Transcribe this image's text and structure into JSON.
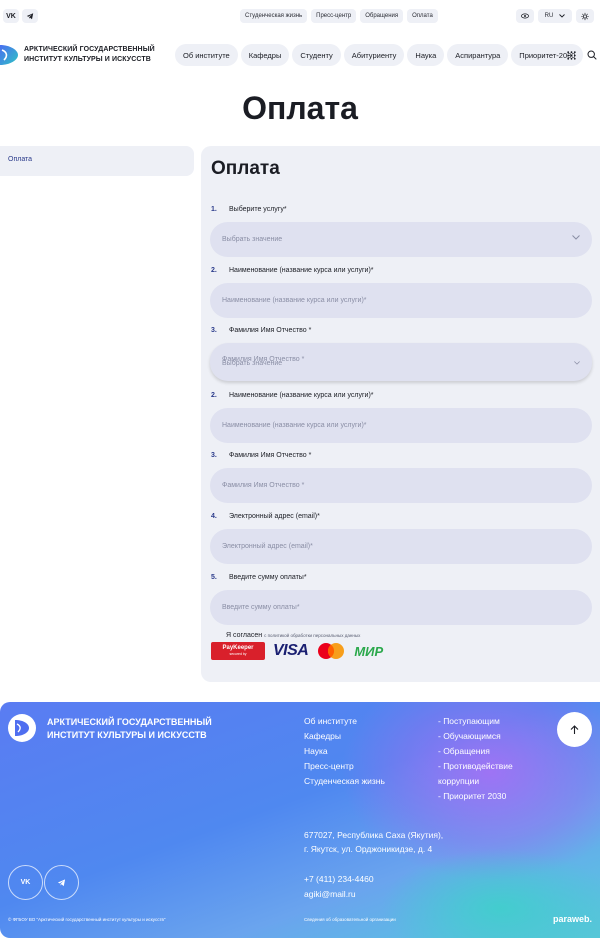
{
  "topbar": {
    "vk_label": "VK",
    "telegram_icon": "telegram-icon",
    "links": [
      "Студенческая жизнь",
      "Пресс-центр",
      "Обращения",
      "Оплата"
    ],
    "lang": "RU"
  },
  "header": {
    "logo_line1": "АРКТИЧЕСКИЙ ГОСУДАРСТВЕННЫЙ",
    "logo_line2": "ИНСТИТУТ КУЛЬТУРЫ И ИСКУССТВ",
    "nav": [
      "Об институте",
      "Кафедры",
      "Студенту",
      "Абитуриенту",
      "Наука",
      "Аспирантура",
      "Приоритет-2030"
    ]
  },
  "page": {
    "title": "Оплата"
  },
  "sidebar": {
    "items": [
      {
        "label": "Оплата"
      }
    ]
  },
  "form": {
    "title": "Оплата",
    "questions": [
      {
        "num": "1.",
        "label": "Выберите услугу*",
        "placeholder": "Выбрать значение",
        "type": "select"
      },
      {
        "num": "2.",
        "label": "Наименование (название курса или услуги)*",
        "placeholder": "Наименование (название курса или услуги)*",
        "type": "text"
      },
      {
        "num": "3.",
        "label": "Фамилия Имя Отчество *",
        "placeholder": "Фамилия Имя Отчество *",
        "overlap": "Выбрать значение",
        "type": "select"
      },
      {
        "num": "2.",
        "label": "Наименование (название курса или услуги)*",
        "placeholder": "Наименование (название курса или услуги)*",
        "type": "text"
      },
      {
        "num": "3.",
        "label": "Фамилия Имя Отчество *",
        "placeholder": "Фамилия Имя Отчество *",
        "type": "text"
      },
      {
        "num": "4.",
        "label": "Электронный адрес (email)*",
        "placeholder": "Электронный адрес (email)*",
        "type": "text"
      },
      {
        "num": "5.",
        "label": "Введите сумму оплаты*",
        "placeholder": "Введите сумму оплаты*",
        "type": "text"
      }
    ],
    "agree_text": "Я согласен",
    "agree_small": "с политикой обработки персональных данных",
    "paykeeper": "PayKeeper",
    "paykeeper_sub": "secured by",
    "visa": "VISA",
    "mastercard": "mastercard",
    "mir": "МИР"
  },
  "footer": {
    "brand_line1": "АРКТИЧЕСКИЙ ГОСУДАРСТВЕННЫЙ",
    "brand_line2": "ИНСТИТУТ КУЛЬТУРЫ И ИСКУССТВ",
    "col1": [
      "Об институте",
      "Кафедры",
      "Наука",
      "Пресс-центр",
      "Студенческая жизнь"
    ],
    "col2": [
      "- Поступающим",
      "- Обучающимся",
      "- Обращения",
      "- Противодействие",
      "коррупции",
      "- Приоритет 2030"
    ],
    "address_line1": "677027, Республика Саха (Якутия),",
    "address_line2": "г. Якутск, ул. Орджоникидзе, д. 4",
    "phone": "+7 (411) 234-4460",
    "email": "agiki@mail.ru",
    "vk_label": "VK",
    "copyright": "© ФГБОУ ВО \"Арктический государственный институт культуры и искусств\"",
    "info": "Сведения об образовательной организации",
    "dev": "paraweb."
  },
  "colors": {
    "accent": "#2a3a8a",
    "field_bg": "#dfe1f0",
    "card_bg": "#eef0f6"
  }
}
